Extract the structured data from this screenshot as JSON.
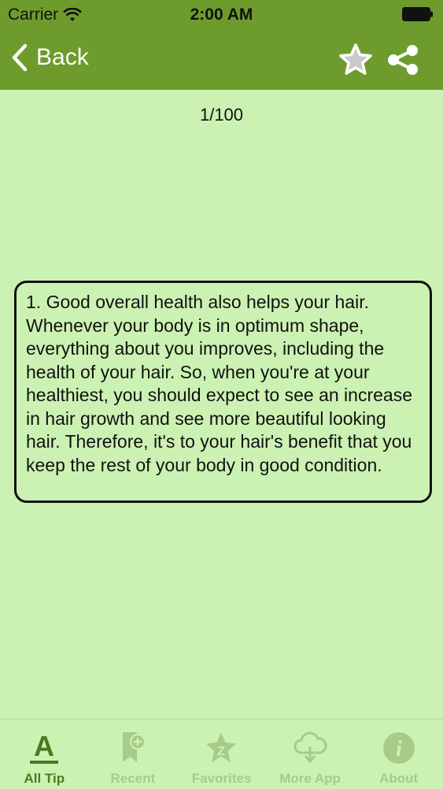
{
  "status_bar": {
    "carrier": "Carrier",
    "time": "2:00 AM"
  },
  "nav": {
    "back_label": "Back",
    "back_icon": "chevron-left-icon",
    "favorite_icon": "star-icon",
    "share_icon": "share-icon"
  },
  "counter": "1/100",
  "tip": {
    "text": "1. Good overall health also helps your hair. Whenever your body is in optimum shape, everything about you improves, including the health of your hair. So, when you're at your healthiest, you should expect to see an increase in hair growth and see more beautiful looking hair. Therefore, it's to your hair's benefit that you keep the rest of your body in good condition."
  },
  "tabs": [
    {
      "label": "All Tip",
      "icon": "letter-a-icon",
      "active": true
    },
    {
      "label": "Recent",
      "icon": "bookmark-plus-icon",
      "active": false
    },
    {
      "label": "Favorites",
      "icon": "star-z-icon",
      "active": false
    },
    {
      "label": "More App",
      "icon": "cloud-download-icon",
      "active": false
    },
    {
      "label": "About",
      "icon": "info-icon",
      "active": false
    }
  ],
  "colors": {
    "nav_bar": "#6d9c2c",
    "background": "#ccf2b3",
    "tab_active": "#4a7a1e",
    "tab_inactive": "#a6cc88"
  }
}
